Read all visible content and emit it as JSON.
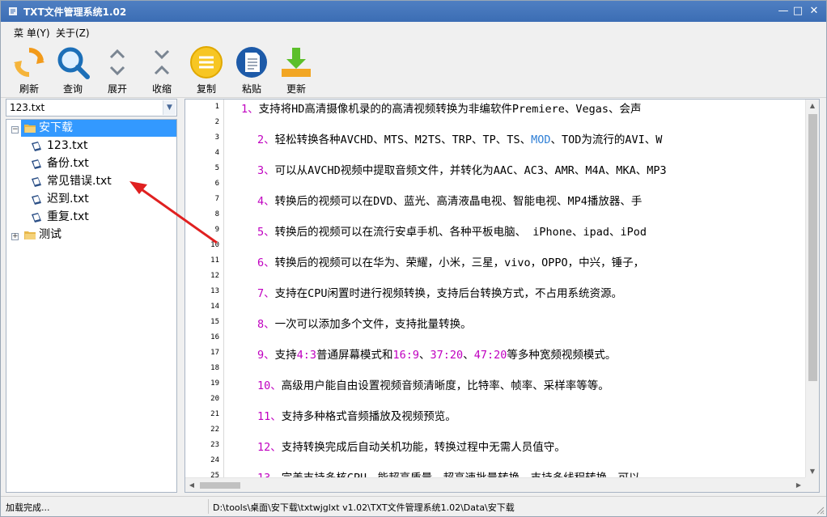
{
  "window": {
    "title": "TXT文件管理系统1.02",
    "controls": {
      "minimize": "—",
      "maximize": "□",
      "close": "✕"
    }
  },
  "menu": {
    "items": [
      {
        "label": "菜 单(Y)"
      },
      {
        "label": "关于(Z)"
      }
    ]
  },
  "toolbar": {
    "buttons": [
      {
        "label": "刷新",
        "icon": "refresh-icon"
      },
      {
        "label": "查询",
        "icon": "search-icon"
      },
      {
        "label": "展开",
        "icon": "expand-icon"
      },
      {
        "label": "收缩",
        "icon": "collapse-icon"
      },
      {
        "label": "复制",
        "icon": "copy-icon"
      },
      {
        "label": "粘贴",
        "icon": "paste-icon"
      },
      {
        "label": "更新",
        "icon": "update-icon"
      }
    ]
  },
  "file_selector": {
    "value": "123.txt"
  },
  "tree": {
    "root": {
      "label": "安下载",
      "expander": "−",
      "children": [
        {
          "label": "123.txt"
        },
        {
          "label": "备份.txt"
        },
        {
          "label": "常见错误.txt"
        },
        {
          "label": "迟到.txt"
        },
        {
          "label": "重复.txt"
        }
      ]
    },
    "second": {
      "label": "测试",
      "expander": "+"
    }
  },
  "editor": {
    "line_numbers": [
      "1",
      "2",
      "3",
      "4",
      "5",
      "6",
      "7",
      "8",
      "9",
      "10",
      "11",
      "12",
      "13",
      "14",
      "15",
      "16",
      "17",
      "18",
      "19",
      "20",
      "21",
      "22",
      "23",
      "24",
      "25"
    ],
    "lines": [
      {
        "n": "1、",
        "text": "支持将HD高清摄像机录的的高清视频转换为非编软件Premiere、Vegas、会声"
      },
      {
        "n": "2、",
        "text": "轻松转换各种AVCHD、MTS、M2TS、TRP、TP、TS、",
        "hl": "MOD",
        "tail": "、TOD为流行的AVI、W"
      },
      {
        "n": "3、",
        "text": "可以从AVCHD视频中提取音频文件，并转化为AAC、AC3、AMR、M4A、MKA、MP3"
      },
      {
        "n": "4、",
        "text": "转换后的视频可以在DVD、蓝光、高清液晶电视、智能电视、MP4播放器、手"
      },
      {
        "n": "5、",
        "text": "转换后的视频可以在流行安卓手机、各种平板电脑、 iPhone、ipad、iPod"
      },
      {
        "n": "6、",
        "text": "转换后的视频可以在华为、荣耀，小米，三星，vivo，OPPO，中兴，锤子，"
      },
      {
        "n": "7、",
        "text": "支持在CPU闲置时进行视频转换，支持后台转换方式，不占用系统资源。"
      },
      {
        "n": "8、",
        "text": "一次可以添加多个文件，支持批量转换。"
      },
      {
        "n": "9、",
        "seg": [
          [
            "t",
            "支持"
          ],
          [
            "n",
            "4:3"
          ],
          [
            "t",
            "普通屏幕模式和"
          ],
          [
            "n",
            "16:9"
          ],
          [
            "t",
            "、"
          ],
          [
            "n",
            "37:20"
          ],
          [
            "t",
            "、"
          ],
          [
            "n",
            "47:20"
          ],
          [
            "t",
            "等多种宽频视频模式。"
          ]
        ]
      },
      {
        "n": "10、",
        "text": "高级用户能自由设置视频音频清晰度，比特率、帧率、采样率等等。"
      },
      {
        "n": "11、",
        "text": "支持多种格式音频播放及视频预览。"
      },
      {
        "n": "12、",
        "text": "支持转换完成后自动关机功能，转换过程中无需人员值守。"
      },
      {
        "n": "13、",
        "text": "完美支持多核CPU，能超高质量、超高速批量转换，支持多线程转换，可以"
      }
    ]
  },
  "status": {
    "left": "加载完成...",
    "path": "D:\\tools\\桌面\\安下载\\txtwjglxt v1.02\\TXT文件管理系统1.02\\Data\\安下载"
  },
  "colors": {
    "titlebar": "#3b6db4",
    "selection": "#3399ff",
    "number_highlight": "#c000c0",
    "link_highlight": "#2f7fd6",
    "annotation_arrow": "#e02020"
  }
}
